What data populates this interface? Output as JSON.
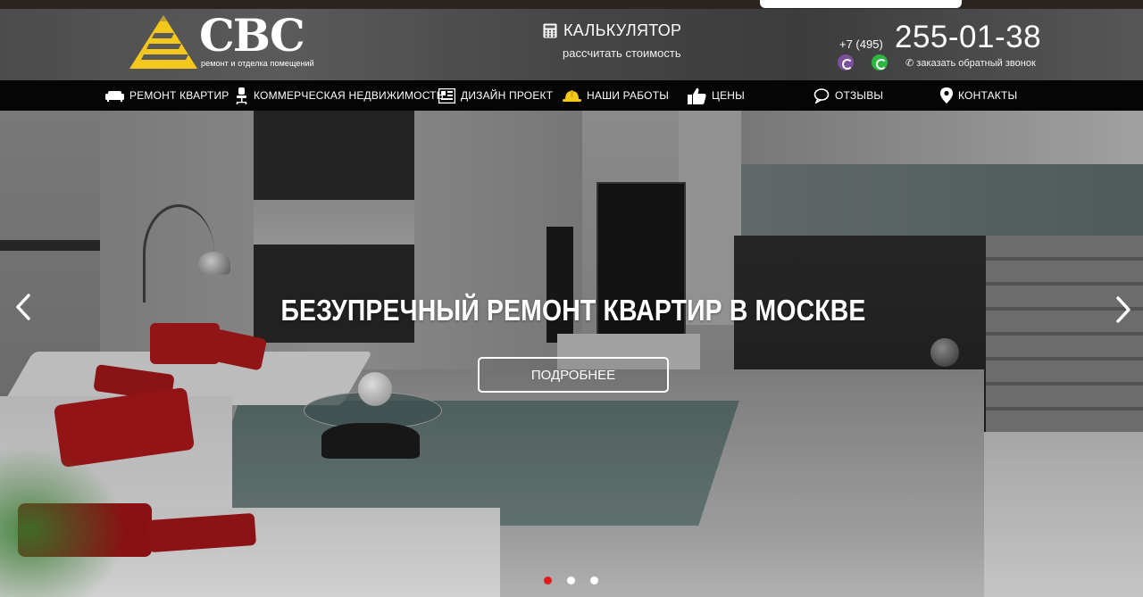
{
  "logo": {
    "brand": "CBC",
    "tagline": "ремонт и отделка помещений"
  },
  "calculator": {
    "icon": "calculator-icon",
    "title": "КАЛЬКУЛЯТОР",
    "subtitle": "рассчитать стоимость"
  },
  "phone": {
    "code": "+7 (495)",
    "number": "255-01-38",
    "callback": "заказать обратный звонок",
    "messengers": [
      "viber-icon",
      "whatsapp-icon"
    ]
  },
  "nav": {
    "items": [
      {
        "label": "РЕМОНТ КВАРТИР",
        "icon": "sofa-icon"
      },
      {
        "label": "КОММЕРЧЕСКАЯ НЕДВИЖИМОСТЬ",
        "icon": "office-chair-icon"
      },
      {
        "label": "ДИЗАЙН ПРОЕКТ",
        "icon": "blueprint-icon"
      },
      {
        "label": "НАШИ РАБОТЫ",
        "icon": "hard-hat-icon"
      },
      {
        "label": "ЦЕНЫ",
        "icon": "thumbs-up-icon"
      },
      {
        "label": "ОТЗЫВЫ",
        "icon": "speech-bubble-icon"
      },
      {
        "label": "КОНТАКТЫ",
        "icon": "map-pin-icon"
      }
    ]
  },
  "hero": {
    "title": "БЕЗУПРЕЧНЫЙ РЕМОНТ КВАРТИР В МОСКВЕ",
    "button": "ПОДРОБНЕЕ",
    "slides": 3,
    "active_slide": 1
  },
  "colors": {
    "accent": "#e21a1a",
    "logo_yellow": "#f3c81b",
    "nav_bg": "#050505"
  }
}
